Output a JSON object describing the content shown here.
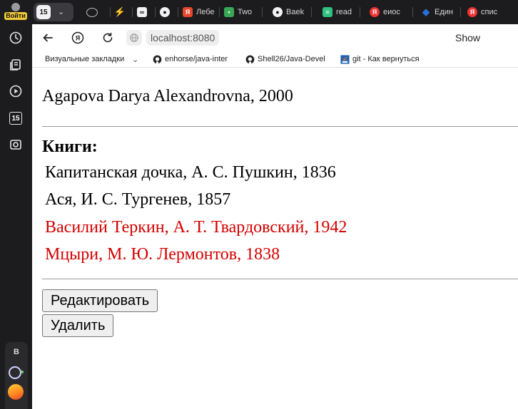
{
  "sidebar": {
    "login_label": "Войти",
    "badge_number": "15",
    "bottom_letter": "B"
  },
  "tabs": {
    "group_number": "15",
    "items": [
      {
        "title": "",
        "icon": "chatgpt-icon",
        "color": "#2b2b2b"
      },
      {
        "title": "",
        "icon": "yandex-icon",
        "color": "#f5a623"
      },
      {
        "title": "",
        "icon": "link-icon",
        "color": "#2b2b2b"
      },
      {
        "title": "",
        "icon": "github-icon",
        "color": "#2b2b2b"
      },
      {
        "title": "Лебе",
        "icon": "rb-icon",
        "color": "#e8452c"
      },
      {
        "title": "Two",
        "icon": "sheet-icon",
        "color": "#3aa757"
      },
      {
        "title": "Baek",
        "icon": "github-icon",
        "color": "#2b2b2b"
      },
      {
        "title": "read",
        "icon": "doc-icon",
        "color": "#2ec27e"
      },
      {
        "title": "еиос",
        "icon": "yandex-icon",
        "color": "#e33"
      },
      {
        "title": "Един",
        "icon": "drop-icon",
        "color": "#2a6fd6"
      },
      {
        "title": "спис",
        "icon": "yandex-icon",
        "color": "#e33"
      }
    ]
  },
  "address_bar": {
    "url": "localhost:8080",
    "show_label": "Show"
  },
  "bookmarks": [
    {
      "label": "Визуальные закладки",
      "icon": "none"
    },
    {
      "label": "enhorse/java-inter",
      "icon": "github-icon"
    },
    {
      "label": "Shell26/Java-Devel",
      "icon": "github-icon"
    },
    {
      "label": "git - Как вернуться",
      "icon": "stackoverflow-icon"
    }
  ],
  "page": {
    "person": "Agapova Darya Alexandrovna, 2000",
    "books_heading": "Книги:",
    "books": [
      {
        "text": "Капитанская дочка, А. С. Пушкин, 1836",
        "color": "#000000"
      },
      {
        "text": "Ася, И. С. Тургенев, 1857",
        "color": "#000000"
      },
      {
        "text": "Василий Теркин, А. Т. Твардовский, 1942",
        "color": "#d20000"
      },
      {
        "text": "Мцыри, М. Ю. Лермонтов, 1838",
        "color": "#d20000"
      }
    ],
    "edit_button": "Редактировать",
    "delete_button": "Удалить"
  }
}
